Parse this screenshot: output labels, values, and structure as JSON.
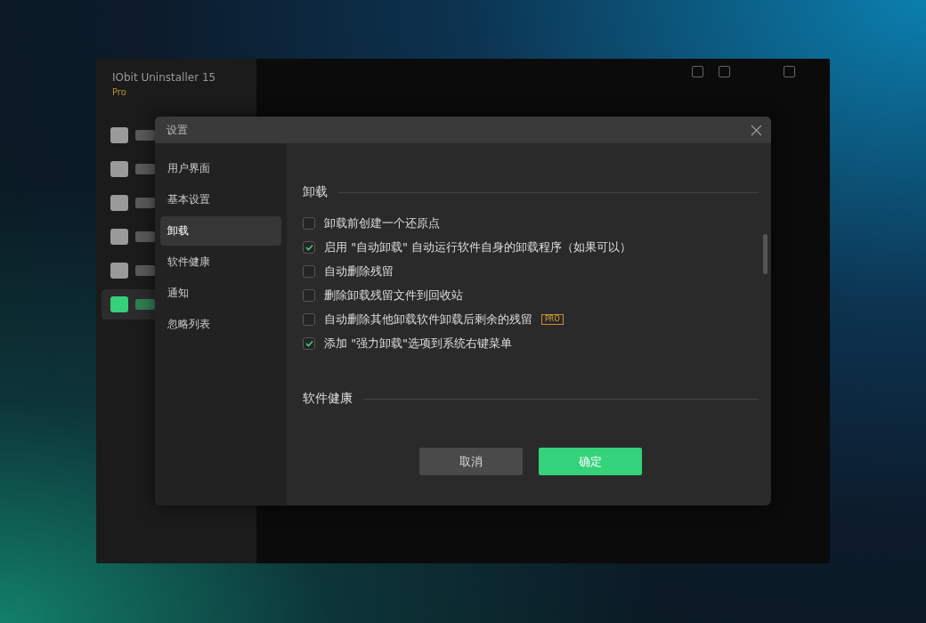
{
  "app": {
    "title": "IObit Uninstaller 15",
    "edition": "Pro",
    "nav_icons": [
      {
        "color": "#9a9a9a"
      },
      {
        "color": "#9a9a9a"
      },
      {
        "color": "#9a9a9a"
      },
      {
        "color": "#9a9a9a"
      },
      {
        "color": "#9a9a9a"
      },
      {
        "color": "#35d07a"
      }
    ]
  },
  "dialog": {
    "title": "设置",
    "nav": [
      {
        "label": "用户界面",
        "selected": false
      },
      {
        "label": "基本设置",
        "selected": false
      },
      {
        "label": "卸载",
        "selected": true
      },
      {
        "label": "软件健康",
        "selected": false
      },
      {
        "label": "通知",
        "selected": false
      },
      {
        "label": "忽略列表",
        "selected": false
      }
    ],
    "sections": [
      {
        "title": "卸载",
        "options": [
          {
            "label": "卸载前创建一个还原点",
            "checked": false
          },
          {
            "label": "启用 \"自动卸载\" 自动运行软件自身的卸载程序（如果可以）",
            "checked": true
          },
          {
            "label": "自动删除残留",
            "checked": false
          },
          {
            "label": "删除卸载残留文件到回收站",
            "checked": false
          },
          {
            "label": "自动删除其他卸载软件卸载后剩余的残留",
            "checked": false,
            "badge": "PRO"
          },
          {
            "label": "添加 \"强力卸载\"选项到系统右键菜单",
            "checked": true
          }
        ]
      },
      {
        "title": "软件健康"
      }
    ],
    "buttons": [
      {
        "label": "取消",
        "kind": "secondary"
      },
      {
        "label": "确定",
        "kind": "primary"
      }
    ]
  }
}
